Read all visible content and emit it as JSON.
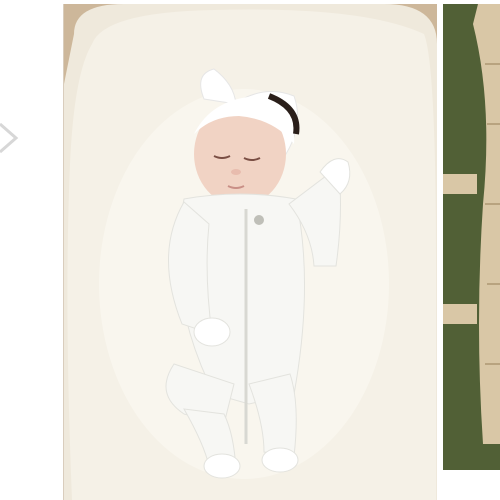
{
  "gallery": {
    "images": [
      {
        "subject": "previous-photo",
        "visible": "partial"
      },
      {
        "subject": "baby-in-white-zip-footie-and-headband-on-lounger",
        "visible": "full"
      },
      {
        "subject": "next-photo-wicker-basket-on-grass",
        "visible": "partial"
      }
    ],
    "icons": {
      "prev": "chevron-left-icon",
      "zoom": "magnifier-icon"
    },
    "colors": {
      "lounger": "#f3efe3",
      "onesie": "#f7f7f4",
      "skin": "#f1d3c4",
      "grass": "#4b5a31",
      "wicker": "#d9c7a6"
    }
  }
}
